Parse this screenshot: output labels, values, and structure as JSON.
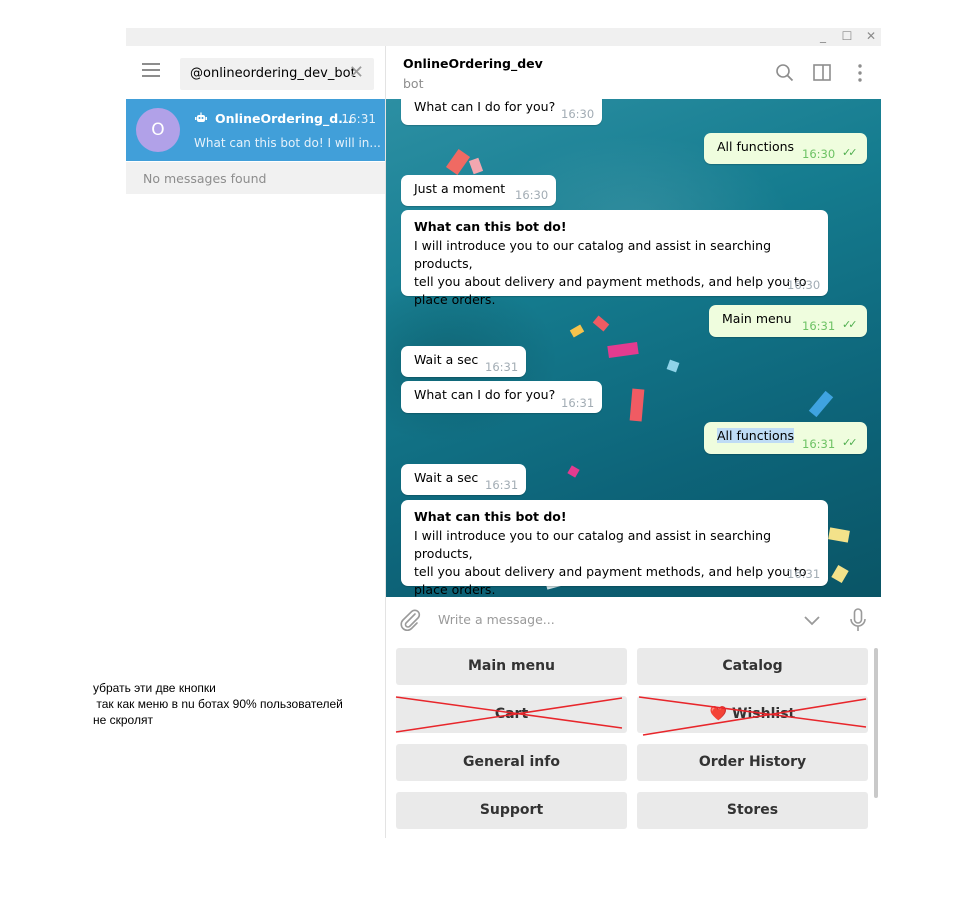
{
  "window": {
    "minimize_glyph": "_",
    "maximize_glyph": "☐",
    "close_glyph": "✕"
  },
  "sidebar": {
    "search_value": "@onlineordering_dev_bot",
    "search_clear_glyph": "✕",
    "chat": {
      "avatar_letter": "O",
      "name": "OnlineOrdering_d...",
      "time": "16:31",
      "preview": "What can this bot do! I will in..."
    },
    "no_results": "No messages found"
  },
  "header": {
    "title": "OnlineOrdering_dev",
    "status": "bot",
    "icons": [
      "search-icon",
      "sidebar-toggle-icon",
      "more-vertical-icon"
    ]
  },
  "messages": [
    {
      "dir": "in",
      "text": "What can I do for you?",
      "time": "16:30"
    },
    {
      "dir": "out",
      "text": "All functions",
      "time": "16:30"
    },
    {
      "dir": "in",
      "text": "Just a moment",
      "time": "16:30"
    },
    {
      "dir": "in",
      "title": "What can this bot do!",
      "body": "I will introduce you to our catalog and assist in searching products,\ntell you about delivery and payment methods, and help you to\nplace orders.",
      "time": "16:30"
    },
    {
      "dir": "out",
      "text": "Main menu",
      "time": "16:31"
    },
    {
      "dir": "in",
      "text": "Wait a sec",
      "time": "16:31"
    },
    {
      "dir": "in",
      "text": "What can I do for you?",
      "time": "16:31"
    },
    {
      "dir": "out",
      "text": "All functions",
      "time": "16:31"
    },
    {
      "dir": "in",
      "text": "Wait a sec",
      "time": "16:31"
    },
    {
      "dir": "in",
      "title": "What can this bot do!",
      "body": "I will introduce you to our catalog and assist in searching products,\ntell you about delivery and payment methods, and help you to\nplace orders.",
      "time": "16:31"
    }
  ],
  "compose": {
    "placeholder": "Write a message..."
  },
  "keyboard": [
    {
      "label": "Main menu"
    },
    {
      "label": "Catalog"
    },
    {
      "label": "Cart",
      "crossed": true
    },
    {
      "label": "❤️ Wishlist",
      "crossed": true
    },
    {
      "label": "General info"
    },
    {
      "label": "Order History"
    },
    {
      "label": "Support"
    },
    {
      "label": "Stores"
    }
  ],
  "annotation": {
    "line1": "убрать эти две кнопки",
    "line2": " так как меню в nu ботах 90% пользователей",
    "line3": "не скролят",
    "strike_color": "#e8262b"
  },
  "colors": {
    "accent": "#419fd9",
    "avatar": "#b1a1e8",
    "outgoing_bubble": "#effdde",
    "check": "#4fae4e"
  }
}
